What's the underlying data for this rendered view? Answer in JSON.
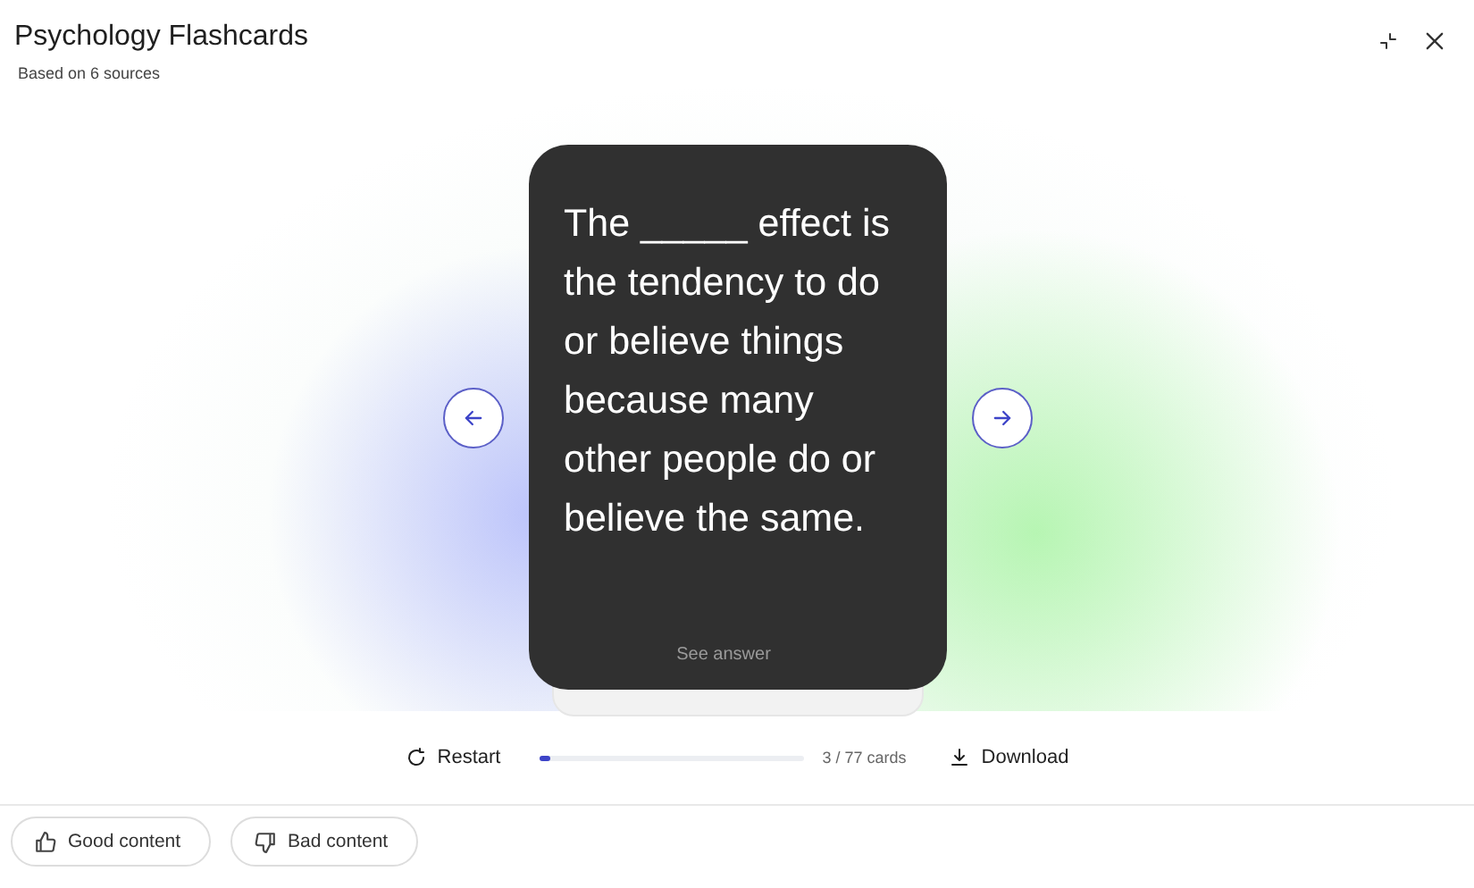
{
  "header": {
    "title": "Psychology Flashcards",
    "subtitle": "Based on 6 sources"
  },
  "card": {
    "question": "The _____ effect is the tendency to do or believe things because many other people do or believe the same.",
    "hint": "See answer"
  },
  "controls": {
    "restart": "Restart",
    "progress": {
      "level": 0.04
    },
    "count": "3 / 77 cards",
    "download": "Download"
  },
  "feedback": [
    {
      "kind": "good",
      "label": "Good content"
    },
    {
      "kind": "bad",
      "label": "Bad content"
    }
  ]
}
